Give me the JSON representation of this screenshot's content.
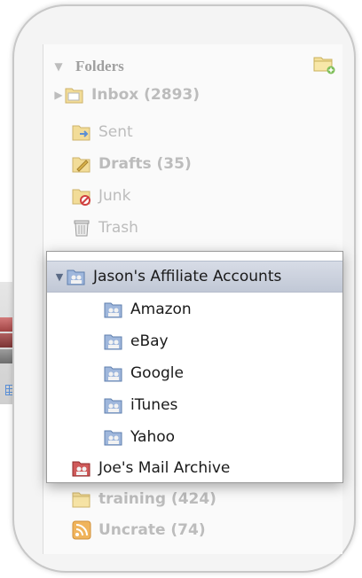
{
  "sidebar": {
    "header": {
      "label": "Folders"
    },
    "folders": [
      {
        "label": "Inbox (2893)",
        "icon": "inbox-folder-icon",
        "bold": true,
        "expandable": true
      },
      {
        "label": "Sent",
        "icon": "sent-folder-icon",
        "bold": false
      },
      {
        "label": "Drafts (35)",
        "icon": "drafts-folder-icon",
        "bold": true
      },
      {
        "label": "Junk",
        "icon": "junk-folder-icon",
        "bold": false
      },
      {
        "label": "Trash",
        "icon": "trash-icon",
        "bold": false
      }
    ],
    "lower_folders": [
      {
        "label": "training (424)",
        "icon": "folder-icon",
        "bold": true
      },
      {
        "label": "Uncrate (74)",
        "icon": "rss-feed-icon",
        "bold": true
      }
    ]
  },
  "popup": {
    "group": {
      "label": "Jason's Affiliate Accounts",
      "expanded": true,
      "selected": true
    },
    "accounts": [
      {
        "label": "Amazon"
      },
      {
        "label": "eBay"
      },
      {
        "label": "Google"
      },
      {
        "label": "iTunes"
      },
      {
        "label": "Yahoo"
      }
    ],
    "archive": {
      "label": "Joe's Mail Archive"
    }
  },
  "colors": {
    "selection": "#c6cdda",
    "account_icon": "#8ea9d2",
    "archive_icon": "#b23a3a",
    "folder_yellow": "#f0cf6a"
  }
}
